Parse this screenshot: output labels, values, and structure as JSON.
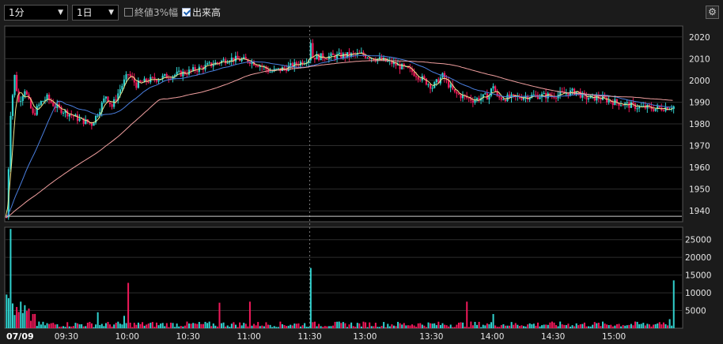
{
  "toolbar": {
    "interval": "1分",
    "period": "1日",
    "close_line_label": "終値3%幅",
    "close_line_checked": false,
    "volume_label": "出来高",
    "volume_checked": true,
    "settings_icon": "gear-icon"
  },
  "colors": {
    "background": "#000000",
    "up": "#31d1ce",
    "down": "#f0195a",
    "ma_short": "#f0e68c",
    "ma_mid": "#4a7fe0",
    "ma_long": "#f2a0a0",
    "grid": "#2c2c2c",
    "axis_text": "#e6e6e6"
  },
  "chart_data": [
    {
      "type": "candlestick",
      "ylim": [
        1935,
        2025
      ],
      "yticks": [
        1940,
        1950,
        1960,
        1970,
        1980,
        1990,
        2000,
        2010,
        2020
      ],
      "x_start": "09:00",
      "x_end": "15:30",
      "session_break": "11:30",
      "reference_line": 1937.5,
      "anchors": [
        [
          "09:00",
          1937
        ],
        [
          "09:01",
          1960
        ],
        [
          "09:02",
          1985
        ],
        [
          "09:04",
          2002
        ],
        [
          "09:06",
          1990
        ],
        [
          "09:09",
          1996
        ],
        [
          "09:13",
          1984
        ],
        [
          "09:17",
          1990
        ],
        [
          "09:20",
          1992
        ],
        [
          "09:24",
          1988
        ],
        [
          "09:30",
          1985
        ],
        [
          "09:36",
          1982
        ],
        [
          "09:42",
          1980
        ],
        [
          "09:45",
          1985
        ],
        [
          "09:49",
          1993
        ],
        [
          "09:52",
          1988
        ],
        [
          "09:56",
          1996
        ],
        [
          "10:00",
          2003
        ],
        [
          "10:04",
          1998
        ],
        [
          "10:10",
          2000
        ],
        [
          "10:20",
          2002
        ],
        [
          "10:30",
          2004
        ],
        [
          "10:40",
          2007
        ],
        [
          "10:50",
          2010
        ],
        [
          "11:00",
          2009
        ],
        [
          "11:05",
          2007
        ],
        [
          "11:10",
          2004
        ],
        [
          "11:15",
          2005
        ],
        [
          "11:22",
          2007
        ],
        [
          "11:29",
          2010
        ],
        [
          "11:30",
          2018
        ],
        [
          "11:33",
          2008
        ],
        [
          "11:40",
          2009
        ],
        [
          "11:50",
          2010
        ],
        [
          "12:40",
          2011
        ],
        [
          "12:55",
          2012
        ],
        [
          "13:10",
          2008
        ],
        [
          "13:20",
          2004
        ],
        [
          "13:26",
          2000
        ],
        [
          "13:30",
          1997
        ],
        [
          "13:35",
          2002
        ],
        [
          "13:41",
          1994
        ],
        [
          "13:50",
          1991
        ],
        [
          "13:58",
          1993
        ],
        [
          "14:00",
          1998
        ],
        [
          "14:02",
          1992
        ],
        [
          "14:10",
          1992
        ],
        [
          "14:20",
          1993
        ],
        [
          "14:29",
          1993
        ],
        [
          "14:35",
          1994
        ],
        [
          "14:41",
          1995
        ],
        [
          "14:45",
          1992
        ],
        [
          "14:52",
          1992
        ],
        [
          "15:00",
          1990
        ],
        [
          "15:10",
          1988
        ],
        [
          "15:20",
          1987
        ],
        [
          "15:29",
          1988
        ]
      ],
      "moving_averages": [
        "short",
        "mid",
        "long"
      ]
    },
    {
      "type": "bar",
      "title": "出来高",
      "ylim": [
        0,
        28500
      ],
      "yticks": [
        5000,
        10000,
        15000,
        20000,
        25000
      ],
      "spikes": [
        [
          "09:00",
          9500
        ],
        [
          "09:01",
          8500
        ],
        [
          "09:02",
          28000
        ],
        [
          "09:03",
          7000
        ],
        [
          "09:05",
          6000
        ],
        [
          "09:07",
          7500
        ],
        [
          "09:09",
          6500
        ],
        [
          "09:13",
          4000
        ],
        [
          "09:45",
          4500
        ],
        [
          "09:58",
          3500
        ],
        [
          "10:00",
          12800
        ],
        [
          "10:45",
          7200
        ],
        [
          "11:00",
          7500
        ],
        [
          "11:30",
          17000
        ],
        [
          "13:47",
          7500
        ],
        [
          "14:00",
          4000
        ],
        [
          "15:30",
          13500
        ]
      ],
      "baseline_typical": 1000
    }
  ],
  "axis": {
    "date_label": "07/09",
    "x_tick_labels": [
      "09:30",
      "10:00",
      "10:30",
      "11:00",
      "11:30",
      "13:00",
      "13:30",
      "14:00",
      "14:30",
      "15:00"
    ],
    "price_tick_labels": [
      "2020",
      "2010",
      "2000",
      "1990",
      "1980",
      "1970",
      "1960",
      "1950",
      "1940"
    ],
    "volume_tick_labels": [
      "25000",
      "20000",
      "15000",
      "10000",
      "5000"
    ]
  }
}
